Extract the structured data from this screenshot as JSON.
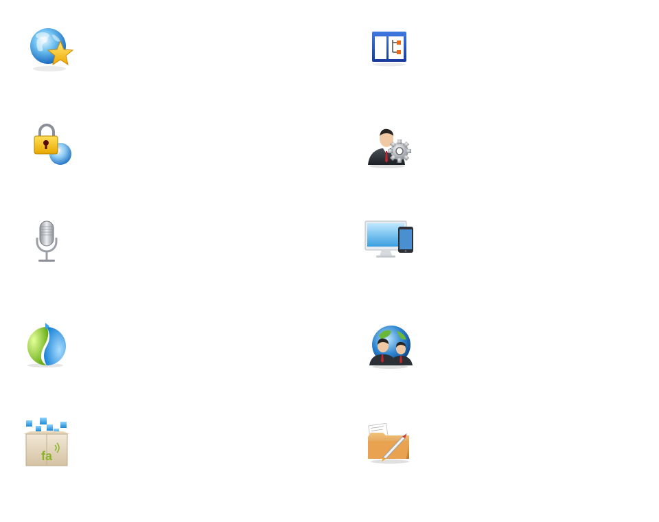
{
  "icons": [
    {
      "id": "globe-star",
      "name": "globe-star-icon"
    },
    {
      "id": "sitemap-window",
      "name": "sitemap-window-icon"
    },
    {
      "id": "lock-globe",
      "name": "lock-globe-icon"
    },
    {
      "id": "user-settings",
      "name": "user-settings-icon"
    },
    {
      "id": "microphone",
      "name": "microphone-icon"
    },
    {
      "id": "monitor-phone",
      "name": "monitor-phone-icon"
    },
    {
      "id": "sync-sphere",
      "name": "sync-sphere-icon"
    },
    {
      "id": "global-users",
      "name": "global-users-icon"
    },
    {
      "id": "box-cubes-fa",
      "name": "box-cubes-fa-icon",
      "label": "fa"
    },
    {
      "id": "folder-rocket",
      "name": "folder-rocket-icon"
    }
  ],
  "colors": {
    "background": "#ffffff",
    "globe_blue": "#3a8fd8",
    "star_gold": "#f5c518",
    "window_blue": "#1f4fb8",
    "connector_orange": "#e86b1a",
    "lock_gold": "#e8b21a",
    "suit_dark": "#2b2f36",
    "tie_red": "#c0262c",
    "mic_silver": "#b8bcc2",
    "monitor_blue": "#5ab6e6",
    "sync_green": "#8ccc2e",
    "sync_blue": "#3aa0e8",
    "box_tan": "#e6d7bf",
    "cube_blue": "#3aa6e6",
    "fa_green": "#8ab42a",
    "folder_tan": "#d89a48"
  }
}
